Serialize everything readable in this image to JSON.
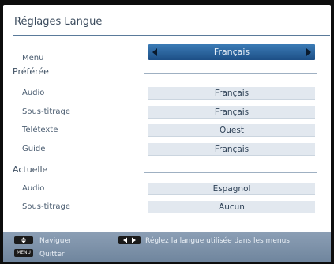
{
  "title": "Réglages Langue",
  "menu": {
    "label": "Menu",
    "value": "Français"
  },
  "preferred": {
    "heading": "Préférée",
    "items": [
      {
        "label": "Audio",
        "value": "Français"
      },
      {
        "label": "Sous-titrage",
        "value": "Français"
      },
      {
        "label": "Télétexte",
        "value": "Ouest"
      },
      {
        "label": "Guide",
        "value": "Français"
      }
    ]
  },
  "current": {
    "heading": "Actuelle",
    "items": [
      {
        "label": "Audio",
        "value": "Espagnol"
      },
      {
        "label": "Sous-titrage",
        "value": "Aucun"
      }
    ]
  },
  "footer": {
    "navigate_label": "Naviguer",
    "menu_key": "MENU",
    "quit_label": "Quitter",
    "hint": "Réglez la langue utilisée dans les menus"
  },
  "colors": {
    "highlight": "#2a639e",
    "value_box": "#e2e8ef",
    "footer": "#7d91a9"
  },
  "icons": {
    "navigate": "up-down-arrows-icon",
    "hint": "left-right-arrows-icon"
  }
}
